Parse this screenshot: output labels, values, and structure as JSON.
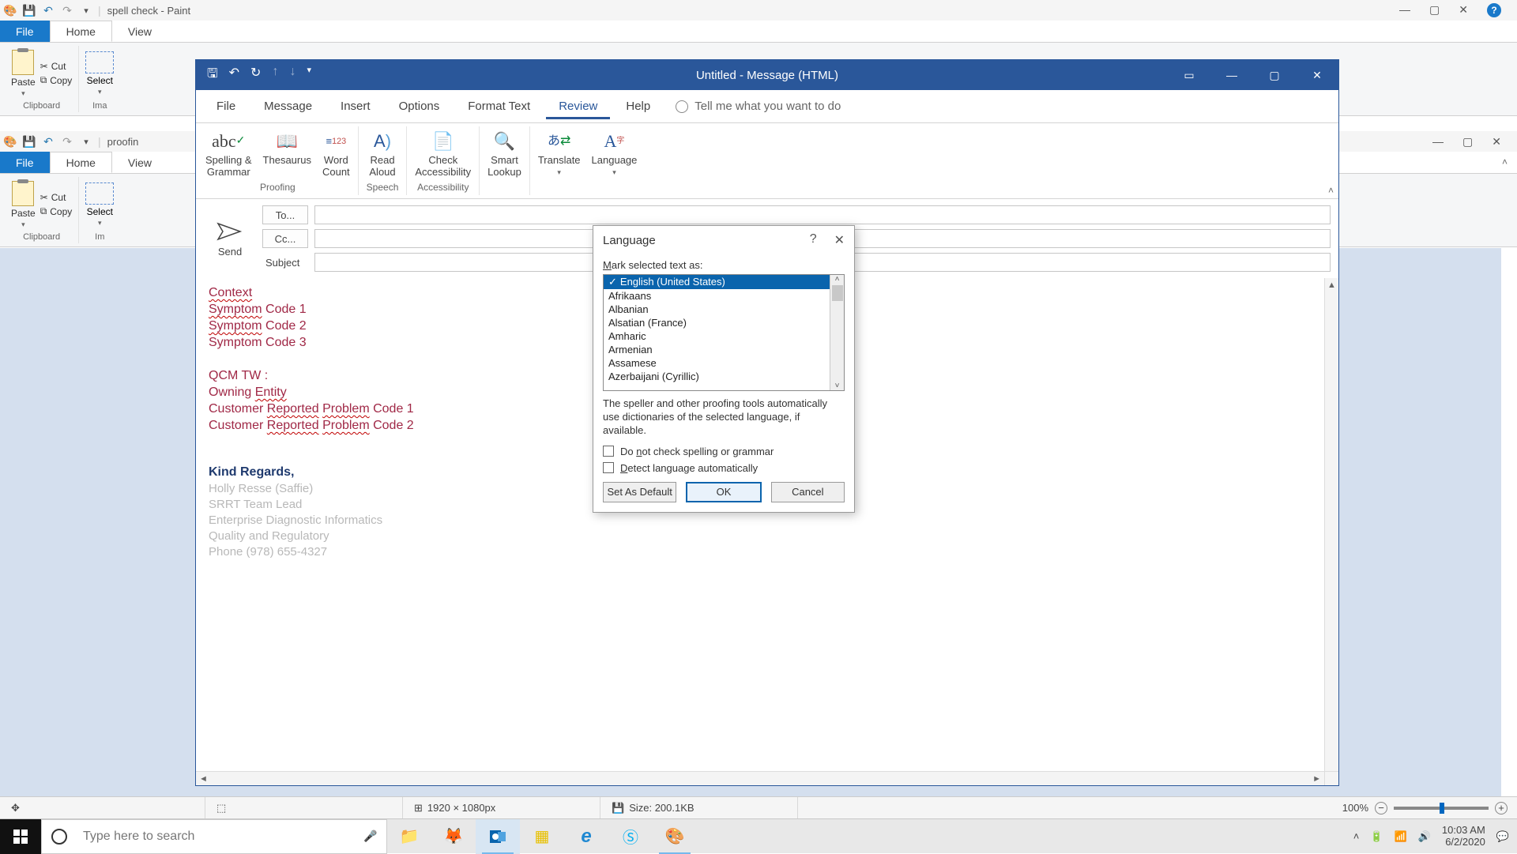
{
  "paint": {
    "title": "spell check - Paint",
    "tabs": {
      "file": "File",
      "home": "Home",
      "view": "View"
    },
    "clipboard": {
      "paste": "Paste",
      "cut": "Cut",
      "copy": "Copy",
      "label": "Clipboard"
    },
    "image": {
      "select": "Select",
      "label": "Ima"
    },
    "title2": "proofin",
    "image2_label": "Im",
    "status": {
      "dims": "1920 × 1080px",
      "size": "Size: 200.1KB",
      "zoom": "100%"
    },
    "collapse_sym": "˄"
  },
  "outlook": {
    "title": "Untitled  -  Message (HTML)",
    "tabs": [
      "File",
      "Message",
      "Insert",
      "Options",
      "Format Text",
      "Review",
      "Help"
    ],
    "active_tab": "Review",
    "tell_me": "Tell me what you want to do",
    "ribbon": {
      "proofing": {
        "spelling": "Spelling &\nGrammar",
        "thesaurus": "Thesaurus",
        "wordcount": "Word\nCount",
        "label": "Proofing"
      },
      "speech": {
        "read": "Read\nAloud",
        "label": "Speech"
      },
      "accessibility": {
        "check": "Check\nAccessibility",
        "label": "Accessibility"
      },
      "insights": {
        "smart": "Smart\nLookup"
      },
      "language": {
        "translate": "Translate",
        "language": "Language"
      }
    },
    "send": "Send",
    "fields": {
      "to": "To...",
      "cc": "Cc...",
      "subject": "Subject"
    },
    "body": {
      "l1": "Context",
      "l2a": "Symptom",
      "l2b": " Code 1",
      "l3a": "Symptom",
      "l3b": " Code 2",
      "l4": "Symptom Code 3",
      "l5": "QCM TW :",
      "l6a": "Owning ",
      "l6b": "Entity",
      "l7a": "Customer ",
      "l7b": "Reported",
      "l7c": " ",
      "l7d": "Problem",
      "l7e": " Code 1",
      "l8a": "Customer ",
      "l8b": "Reported",
      "l8c": " ",
      "l8d": "Problem",
      "l8e": " Code 2",
      "kind": "Kind Regards,",
      "s1": "Holly Resse (Saffie)",
      "s2": "SRRT Team Lead",
      "s3": "Enterprise Diagnostic Informatics",
      "s4": "Quality and Regulatory",
      "s5": "Phone (978) 655-4327"
    }
  },
  "lang": {
    "title": "Language",
    "mark_label": "Mark selected text as:",
    "mark_key": "M",
    "items": [
      "English (United States)",
      "Afrikaans",
      "Albanian",
      "Alsatian (France)",
      "Amharic",
      "Armenian",
      "Assamese",
      "Azerbaijani (Cyrillic)"
    ],
    "note": "The speller and other proofing tools automatically use dictionaries of the selected language, if available.",
    "chk1_pre": "Do ",
    "chk1_key": "n",
    "chk1_post": "ot check spelling or grammar",
    "chk2_pre": "",
    "chk2_key": "D",
    "chk2_post": "etect language automatically",
    "btn_default": "Set As Default",
    "btn_ok": "OK",
    "btn_cancel": "Cancel"
  },
  "taskbar": {
    "search_placeholder": "Type here to search",
    "time": "10:03 AM",
    "date": "6/2/2020"
  }
}
